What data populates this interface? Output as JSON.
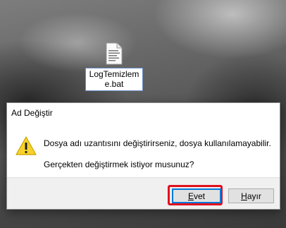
{
  "desktop": {
    "file_icon": "bat-file-icon",
    "file_name": "LogTemizleme.bat"
  },
  "dialog": {
    "title": "Ad Değiştir",
    "icon": "warning-icon",
    "message_line1": "Dosya adı uzantısını değiştirirseniz, dosya kullanılamayabilir.",
    "message_line2": "Gerçekten değiştirmek istiyor musunuz?",
    "yes_label": "Evet",
    "no_label": "Hayır",
    "highlight_color": "#e0101e",
    "warning_color": "#f7d22a"
  }
}
